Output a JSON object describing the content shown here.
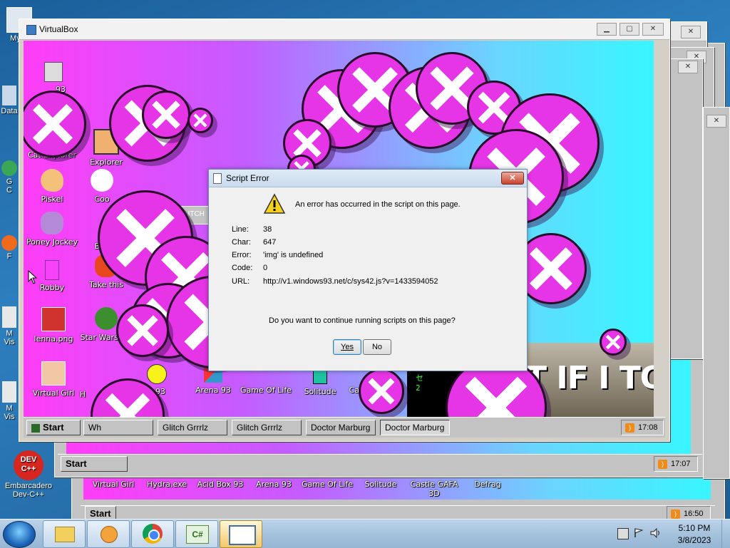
{
  "desktop": {
    "icons": [
      {
        "label": "My C"
      },
      {
        "label": "Data"
      },
      {
        "label": "G\nC"
      },
      {
        "label": "F"
      },
      {
        "label": "M\nVis"
      },
      {
        "label": "M\nVis"
      },
      {
        "label": "Embarcadero\nDev-C++"
      }
    ],
    "devcpp_badge": "DEV\nC++"
  },
  "win7_taskbar": {
    "time": "5:10 PM",
    "date": "3/8/2023",
    "csharp_label": "C#"
  },
  "window_back3": {
    "icons": [
      "Virtual Girl",
      "Hydra.exe",
      "Acid Box 93",
      "Arena 93",
      "Game Of Life",
      "Solitude",
      "Castle GAFA\n3D",
      "Defrag"
    ],
    "start": "Start",
    "clock": "16:50"
  },
  "window_back2": {
    "start": "Start",
    "clock": "17:07"
  },
  "virtualbox": {
    "title": "VirtualBox",
    "icons": [
      {
        "label": "93"
      },
      {
        "label": "Cat Explorer"
      },
      {
        "label": "Explorer"
      },
      {
        "label": "Piskel"
      },
      {
        "label": "Coo"
      },
      {
        "label": "Poney Jockey"
      },
      {
        "label": "Byu"
      },
      {
        "label": "Robby"
      },
      {
        "label": "Take this"
      },
      {
        "label": "lenna.png"
      },
      {
        "label": "Star Wars.avi"
      },
      {
        "label": "Virtual Girl"
      },
      {
        "label": "H"
      },
      {
        "label": "x 93"
      },
      {
        "label": "Arena 93"
      },
      {
        "label": "Game Of Life"
      },
      {
        "label": "Solitude"
      },
      {
        "label": "Castle GAFA\n3D"
      }
    ],
    "glitch_label": "LITCH",
    "meme_text": "T IF I TO",
    "matrix_text": "0\nハ\nセ\n2",
    "taskbar": {
      "start": "Start",
      "buttons": [
        "Wh",
        "Glitch Grrrlz",
        "Glitch Grrrlz",
        "Doctor Marburg",
        "Doctor Marburg"
      ],
      "clock": "17:08"
    }
  },
  "dialog": {
    "title": "Script Error",
    "message": "An error has occurred in the script on this page.",
    "rows": [
      {
        "label": "Line:",
        "value": "38"
      },
      {
        "label": "Char:",
        "value": "647"
      },
      {
        "label": "Error:",
        "value": "'img' is undefined"
      },
      {
        "label": "Code:",
        "value": "0"
      },
      {
        "label": "URL:",
        "value": "http://v1.windows93.net/c/sys42.js?v=1433594052"
      }
    ],
    "question": "Do you want to continue running scripts on this page?",
    "yes": "Yes",
    "no": "No"
  },
  "colors": {
    "bubble": "#e635e6",
    "screen_left": "#ff3df7",
    "screen_right": "#38f5ff"
  }
}
